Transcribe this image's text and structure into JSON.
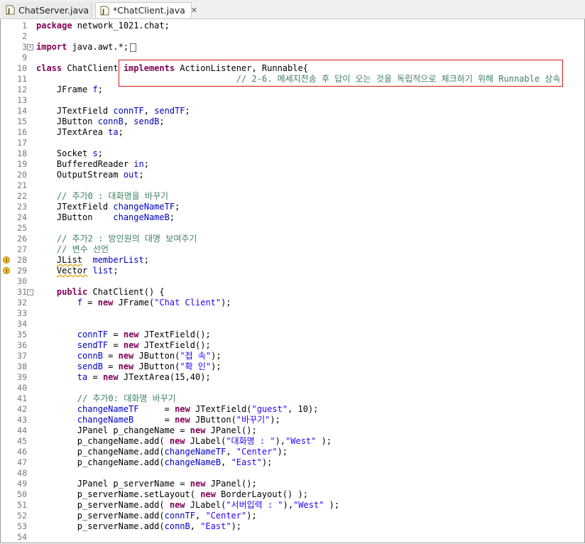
{
  "tabs": [
    {
      "label": "ChatServer.java",
      "active": false
    },
    {
      "label": "*ChatClient.java",
      "active": true,
      "close": "✕"
    }
  ],
  "colors": {
    "keyword": "#7f0055",
    "field": "#0000c0",
    "string": "#2a00ff",
    "comment": "#3f7f5f",
    "highlight_box": "#d11a1a"
  },
  "icons": [
    "java-file-icon",
    "close-icon",
    "fold-expand-icon",
    "fold-collapse-icon",
    "warning-icon"
  ],
  "editor": {
    "lines": [
      {
        "n": "1",
        "tokens": [
          [
            "kw",
            "package"
          ],
          [
            "t",
            " network_1021.chat;"
          ]
        ]
      },
      {
        "n": "2",
        "tokens": []
      },
      {
        "n": "3",
        "fold": "+",
        "tokens": [
          [
            "kw",
            "import"
          ],
          [
            "t",
            " java.awt.*;"
          ],
          [
            "box",
            ""
          ]
        ]
      },
      {
        "n": "9",
        "tokens": []
      },
      {
        "n": "10",
        "tokens": [
          [
            "kw",
            "class"
          ],
          [
            "t",
            " ChatClient "
          ],
          [
            "kw",
            "implements"
          ],
          [
            "t",
            " ActionListener, Runnable{"
          ]
        ]
      },
      {
        "n": "11",
        "tokens": [
          [
            "t",
            "                                       "
          ],
          [
            "cmt",
            "// 2-6. 메세지전송 후 답이 오는 것을 독립적으로 체크하기 위해 Runnable 상속"
          ]
        ]
      },
      {
        "n": "12",
        "tokens": [
          [
            "t",
            "    JFrame "
          ],
          [
            "fld",
            "f"
          ],
          [
            "t",
            ";"
          ]
        ]
      },
      {
        "n": "13",
        "tokens": []
      },
      {
        "n": "14",
        "tokens": [
          [
            "t",
            "    JTextField "
          ],
          [
            "fld",
            "connTF"
          ],
          [
            "t",
            ", "
          ],
          [
            "fld",
            "sendTF"
          ],
          [
            "t",
            ";"
          ]
        ]
      },
      {
        "n": "15",
        "tokens": [
          [
            "t",
            "    JButton "
          ],
          [
            "fld",
            "connB"
          ],
          [
            "t",
            ", "
          ],
          [
            "fld",
            "sendB"
          ],
          [
            "t",
            ";"
          ]
        ]
      },
      {
        "n": "16",
        "tokens": [
          [
            "t",
            "    JTextArea "
          ],
          [
            "fld",
            "ta"
          ],
          [
            "t",
            ";"
          ]
        ]
      },
      {
        "n": "17",
        "tokens": []
      },
      {
        "n": "18",
        "tokens": [
          [
            "t",
            "    Socket "
          ],
          [
            "fld",
            "s"
          ],
          [
            "t",
            ";"
          ]
        ]
      },
      {
        "n": "19",
        "tokens": [
          [
            "t",
            "    BufferedReader "
          ],
          [
            "fld",
            "in"
          ],
          [
            "t",
            ";"
          ]
        ]
      },
      {
        "n": "20",
        "tokens": [
          [
            "t",
            "    OutputStream "
          ],
          [
            "fld",
            "out"
          ],
          [
            "t",
            ";"
          ]
        ]
      },
      {
        "n": "21",
        "tokens": []
      },
      {
        "n": "22",
        "tokens": [
          [
            "t",
            "    "
          ],
          [
            "cmt",
            "// 추가0 : 대화명을 바꾸기"
          ]
        ]
      },
      {
        "n": "23",
        "tokens": [
          [
            "t",
            "    JTextField "
          ],
          [
            "fld",
            "changeNameTF"
          ],
          [
            "t",
            ";"
          ]
        ]
      },
      {
        "n": "24",
        "tokens": [
          [
            "t",
            "    JButton    "
          ],
          [
            "fld",
            "changeNameB"
          ],
          [
            "t",
            ";"
          ]
        ]
      },
      {
        "n": "25",
        "tokens": []
      },
      {
        "n": "26",
        "tokens": [
          [
            "t",
            "    "
          ],
          [
            "cmt",
            "// 추가2 : 방인원의 대명 보여주기"
          ]
        ]
      },
      {
        "n": "27",
        "tokens": [
          [
            "t",
            "    "
          ],
          [
            "cmt",
            "// 변수 선언"
          ]
        ]
      },
      {
        "n": "28",
        "warn": true,
        "tokens": [
          [
            "t",
            "    "
          ],
          [
            "sq",
            "JList"
          ],
          [
            "t",
            "  "
          ],
          [
            "fld",
            "memberList"
          ],
          [
            "t",
            ";"
          ]
        ]
      },
      {
        "n": "29",
        "warn": true,
        "tokens": [
          [
            "t",
            "    "
          ],
          [
            "sq",
            "Vector"
          ],
          [
            "t",
            " "
          ],
          [
            "fld",
            "list"
          ],
          [
            "t",
            ";"
          ]
        ]
      },
      {
        "n": "30",
        "tokens": []
      },
      {
        "n": "31",
        "fold": "−",
        "tokens": [
          [
            "t",
            "    "
          ],
          [
            "kw",
            "public"
          ],
          [
            "t",
            " ChatClient() {"
          ]
        ]
      },
      {
        "n": "32",
        "tokens": [
          [
            "t",
            "        "
          ],
          [
            "fld",
            "f"
          ],
          [
            "t",
            " = "
          ],
          [
            "kw",
            "new"
          ],
          [
            "t",
            " JFrame("
          ],
          [
            "str",
            "\"Chat Client\""
          ],
          [
            "t",
            ");"
          ]
        ]
      },
      {
        "n": "33",
        "tokens": []
      },
      {
        "n": "34",
        "tokens": []
      },
      {
        "n": "35",
        "tokens": [
          [
            "t",
            "        "
          ],
          [
            "fld",
            "connTF"
          ],
          [
            "t",
            " = "
          ],
          [
            "kw",
            "new"
          ],
          [
            "t",
            " JTextField();"
          ]
        ]
      },
      {
        "n": "36",
        "tokens": [
          [
            "t",
            "        "
          ],
          [
            "fld",
            "sendTF"
          ],
          [
            "t",
            " = "
          ],
          [
            "kw",
            "new"
          ],
          [
            "t",
            " JTextField();"
          ]
        ]
      },
      {
        "n": "37",
        "tokens": [
          [
            "t",
            "        "
          ],
          [
            "fld",
            "connB"
          ],
          [
            "t",
            " = "
          ],
          [
            "kw",
            "new"
          ],
          [
            "t",
            " JButton("
          ],
          [
            "str",
            "\"접 속\""
          ],
          [
            "t",
            ");"
          ]
        ]
      },
      {
        "n": "38",
        "tokens": [
          [
            "t",
            "        "
          ],
          [
            "fld",
            "sendB"
          ],
          [
            "t",
            " = "
          ],
          [
            "kw",
            "new"
          ],
          [
            "t",
            " JButton("
          ],
          [
            "str",
            "\"확 인\""
          ],
          [
            "t",
            ");"
          ]
        ]
      },
      {
        "n": "39",
        "tokens": [
          [
            "t",
            "        "
          ],
          [
            "fld",
            "ta"
          ],
          [
            "t",
            " = "
          ],
          [
            "kw",
            "new"
          ],
          [
            "t",
            " JTextArea(15,40);"
          ]
        ]
      },
      {
        "n": "40",
        "tokens": []
      },
      {
        "n": "41",
        "tokens": [
          [
            "t",
            "        "
          ],
          [
            "cmt",
            "// 추가0: 대화명 바꾸기"
          ]
        ]
      },
      {
        "n": "42",
        "tokens": [
          [
            "t",
            "        "
          ],
          [
            "fld",
            "changeNameTF"
          ],
          [
            "t",
            "     = "
          ],
          [
            "kw",
            "new"
          ],
          [
            "t",
            " JTextField("
          ],
          [
            "str",
            "\"guest\""
          ],
          [
            "t",
            ", 10);"
          ]
        ]
      },
      {
        "n": "43",
        "tokens": [
          [
            "t",
            "        "
          ],
          [
            "fld",
            "changeNameB"
          ],
          [
            "t",
            "      = "
          ],
          [
            "kw",
            "new"
          ],
          [
            "t",
            " JButton("
          ],
          [
            "str",
            "\"바꾸기\""
          ],
          [
            "t",
            ");"
          ]
        ]
      },
      {
        "n": "44",
        "tokens": [
          [
            "t",
            "        JPanel p_changeName = "
          ],
          [
            "kw",
            "new"
          ],
          [
            "t",
            " JPanel();"
          ]
        ]
      },
      {
        "n": "45",
        "tokens": [
          [
            "t",
            "        p_changeName.add( "
          ],
          [
            "kw",
            "new"
          ],
          [
            "t",
            " JLabel("
          ],
          [
            "str",
            "\"대화명 : \""
          ],
          [
            "t",
            "),"
          ],
          [
            "str",
            "\"West\""
          ],
          [
            "t",
            " );"
          ]
        ]
      },
      {
        "n": "46",
        "tokens": [
          [
            "t",
            "        p_changeName.add("
          ],
          [
            "fld",
            "changeNameTF"
          ],
          [
            "t",
            ", "
          ],
          [
            "str",
            "\"Center\""
          ],
          [
            "t",
            ");"
          ]
        ]
      },
      {
        "n": "47",
        "tokens": [
          [
            "t",
            "        p_changeName.add("
          ],
          [
            "fld",
            "changeNameB"
          ],
          [
            "t",
            ", "
          ],
          [
            "str",
            "\"East\""
          ],
          [
            "t",
            ");"
          ]
        ]
      },
      {
        "n": "48",
        "tokens": []
      },
      {
        "n": "49",
        "tokens": [
          [
            "t",
            "        JPanel p_serverName = "
          ],
          [
            "kw",
            "new"
          ],
          [
            "t",
            " JPanel();"
          ]
        ]
      },
      {
        "n": "50",
        "tokens": [
          [
            "t",
            "        p_serverName.setLayout( "
          ],
          [
            "kw",
            "new"
          ],
          [
            "t",
            " BorderLayout() );"
          ]
        ]
      },
      {
        "n": "51",
        "tokens": [
          [
            "t",
            "        p_serverName.add( "
          ],
          [
            "kw",
            "new"
          ],
          [
            "t",
            " JLabel("
          ],
          [
            "str",
            "\"서버입력 : \""
          ],
          [
            "t",
            "),"
          ],
          [
            "str",
            "\"West\""
          ],
          [
            "t",
            " );"
          ]
        ]
      },
      {
        "n": "52",
        "tokens": [
          [
            "t",
            "        p_serverName.add("
          ],
          [
            "fld",
            "connTF"
          ],
          [
            "t",
            ", "
          ],
          [
            "str",
            "\"Center\""
          ],
          [
            "t",
            ");"
          ]
        ]
      },
      {
        "n": "53",
        "tokens": [
          [
            "t",
            "        p_serverName.add("
          ],
          [
            "fld",
            "connB"
          ],
          [
            "t",
            ", "
          ],
          [
            "str",
            "\"East\""
          ],
          [
            "t",
            ");"
          ]
        ]
      },
      {
        "n": "54",
        "tokens": []
      }
    ]
  }
}
